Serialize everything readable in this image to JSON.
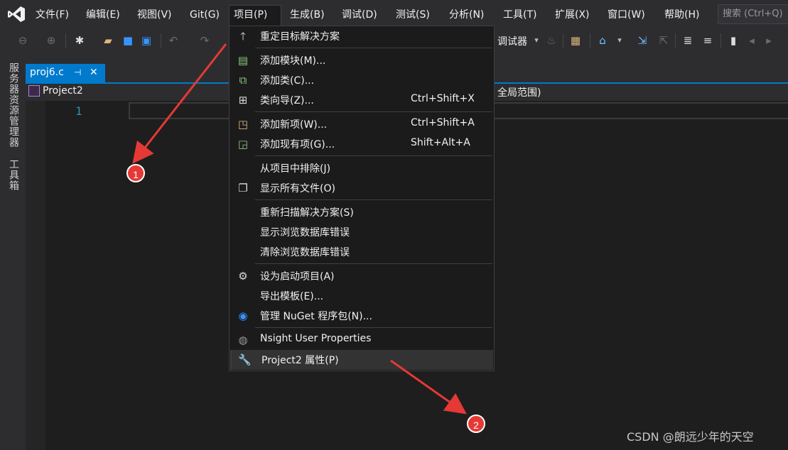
{
  "menubar": {
    "items": [
      "文件(F)",
      "编辑(E)",
      "视图(V)",
      "Git(G)",
      "项目(P)",
      "生成(B)",
      "调试(D)",
      "测试(S)",
      "分析(N)",
      "工具(T)",
      "扩展(X)",
      "窗口(W)",
      "帮助(H)"
    ],
    "search_placeholder": "搜索 (Ctrl+Q)",
    "active_item": "项目(P)"
  },
  "toolbar": {
    "debugger_label": "调试器"
  },
  "left_strip": {
    "server_explorer": "服务器资源管理器",
    "toolbox": "工具箱"
  },
  "tab": {
    "label": "proj6.c",
    "pin_icon": "pin-icon",
    "close_icon": "close-icon"
  },
  "navbar": {
    "project": "Project2",
    "scope": "全局范围)"
  },
  "editor": {
    "line_number": "1"
  },
  "dropdown": {
    "items": [
      {
        "icon": "arrow-up-icon",
        "label": "重定目标解决方案",
        "shortcut": ""
      },
      {
        "icon": "add-module-icon",
        "label": "添加模块(M)...",
        "shortcut": ""
      },
      {
        "icon": "add-class-icon",
        "label": "添加类(C)...",
        "shortcut": ""
      },
      {
        "icon": "class-wizard-icon",
        "label": "类向导(Z)...",
        "shortcut": "Ctrl+Shift+X"
      },
      {
        "icon": "add-new-item-icon",
        "label": "添加新项(W)...",
        "shortcut": "Ctrl+Shift+A"
      },
      {
        "icon": "add-existing-item-icon",
        "label": "添加现有项(G)...",
        "shortcut": "Shift+Alt+A"
      },
      {
        "icon": "",
        "label": "从项目中排除(J)",
        "shortcut": ""
      },
      {
        "icon": "show-all-files-icon",
        "label": "显示所有文件(O)",
        "shortcut": ""
      },
      {
        "icon": "",
        "label": "重新扫描解决方案(S)",
        "shortcut": ""
      },
      {
        "icon": "",
        "label": "显示浏览数据库错误",
        "shortcut": ""
      },
      {
        "icon": "",
        "label": "清除浏览数据库错误",
        "shortcut": ""
      },
      {
        "icon": "gear-icon",
        "label": "设为启动项目(A)",
        "shortcut": ""
      },
      {
        "icon": "",
        "label": "导出模板(E)...",
        "shortcut": ""
      },
      {
        "icon": "nuget-icon",
        "label": "管理 NuGet 程序包(N)...",
        "shortcut": ""
      },
      {
        "icon": "nsight-icon",
        "label": "Nsight User Properties",
        "shortcut": ""
      },
      {
        "icon": "wrench-icon",
        "label": "Project2 属性(P)",
        "shortcut": ""
      }
    ]
  },
  "annotations": {
    "badge1": "1",
    "badge2": "2",
    "arrow_color": "#e53935"
  },
  "watermark": "CSDN @朗远少年的天空",
  "colors": {
    "accent": "#007acc",
    "menu_bg": "#1b1b1c",
    "chrome_bg": "#2d2d30",
    "editor_bg": "#1e1e1e"
  }
}
